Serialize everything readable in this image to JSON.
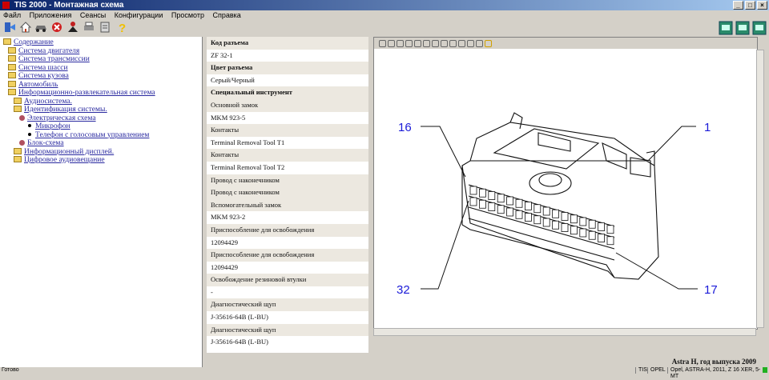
{
  "window": {
    "title": "TIS 2000 - Монтажная схема"
  },
  "menu": [
    "Файл",
    "Приложения",
    "Сеансы",
    "Конфигурации",
    "Просмотр",
    "Справка"
  ],
  "toolbar": {
    "icons": [
      "exit-icon",
      "home-icon",
      "car-icon",
      "stop-icon",
      "person-icon",
      "printer-icon",
      "help-icon"
    ]
  },
  "tree": [
    {
      "label": "Содержание",
      "level": 0,
      "icon": "folder"
    },
    {
      "label": "Система двигателя",
      "level": 1,
      "icon": "folder"
    },
    {
      "label": "Система трансмиссии",
      "level": 1,
      "icon": "folder"
    },
    {
      "label": "Система шасси",
      "level": 1,
      "icon": "folder"
    },
    {
      "label": "Система кузова",
      "level": 1,
      "icon": "folder"
    },
    {
      "label": "Автомобиль",
      "level": 1,
      "icon": "folder"
    },
    {
      "label": "Информационно-развлекательная система",
      "level": 1,
      "icon": "folder"
    },
    {
      "label": "Аудиосистема.",
      "level": 2,
      "icon": "folder"
    },
    {
      "label": "Идентификация системы.",
      "level": 2,
      "icon": "folder"
    },
    {
      "label": "Электрическая схема",
      "level": 3,
      "icon": "schematic"
    },
    {
      "label": "Микрофон",
      "level": 4,
      "icon": "bullet"
    },
    {
      "label": "Телефон с голосовым управлением",
      "level": 4,
      "icon": "bullet"
    },
    {
      "label": "Блок-схема",
      "level": 3,
      "icon": "schematic"
    },
    {
      "label": "Информационный дисплей.",
      "level": 2,
      "icon": "folder"
    },
    {
      "label": "Цифровое аудиовещание",
      "level": 2,
      "icon": "folder"
    }
  ],
  "properties": [
    {
      "label": "Код разъема",
      "value": "ZF 32-1",
      "bold": true
    },
    {
      "label": "Цвет разъема",
      "value": "Серый/Черный",
      "bold": true
    },
    {
      "label": "Специальный инструмент",
      "value": null,
      "bold": true
    },
    {
      "label": "Основной замок",
      "value": "MKM 923-5",
      "bold": false
    },
    {
      "label": "Контакты",
      "value": "Terminal Removal Tool T1",
      "bold": false
    },
    {
      "label": "Контакты",
      "value": "Terminal Removal Tool T2",
      "bold": false
    },
    {
      "label": "Провод с наконечником",
      "value": null,
      "bold": false
    },
    {
      "label": "Провод с наконечником",
      "value": null,
      "bold": false
    },
    {
      "label": "Вспомогательный замок",
      "value": "MKM 923-2",
      "bold": false
    },
    {
      "label": "Приспособление для освобождения",
      "value": "12094429",
      "bold": false
    },
    {
      "label": "Приспособление для освобождения",
      "value": "12094429",
      "bold": false
    },
    {
      "label": "Освобождение резиновой втулки",
      "value": "-",
      "bold": false
    },
    {
      "label": "Диагностический щуп",
      "value": "J-35616-64B (L-BU)",
      "bold": false
    },
    {
      "label": "Диагностический щуп",
      "value": "J-35616-64B (L-BU)",
      "bold": false
    }
  ],
  "diagram": {
    "pin_labels": {
      "top_left": "16",
      "top_right": "1",
      "bottom_left": "32",
      "bottom_right": "17"
    },
    "label_color": "#1a1ad8"
  },
  "caption": "Astra H, год выпуска 2009",
  "status": {
    "left": "Готово",
    "cells": [
      "TIS",
      "OPEL",
      "Opel, ASTRA-H, 2011, Z 16 XER, 5-MT"
    ]
  }
}
